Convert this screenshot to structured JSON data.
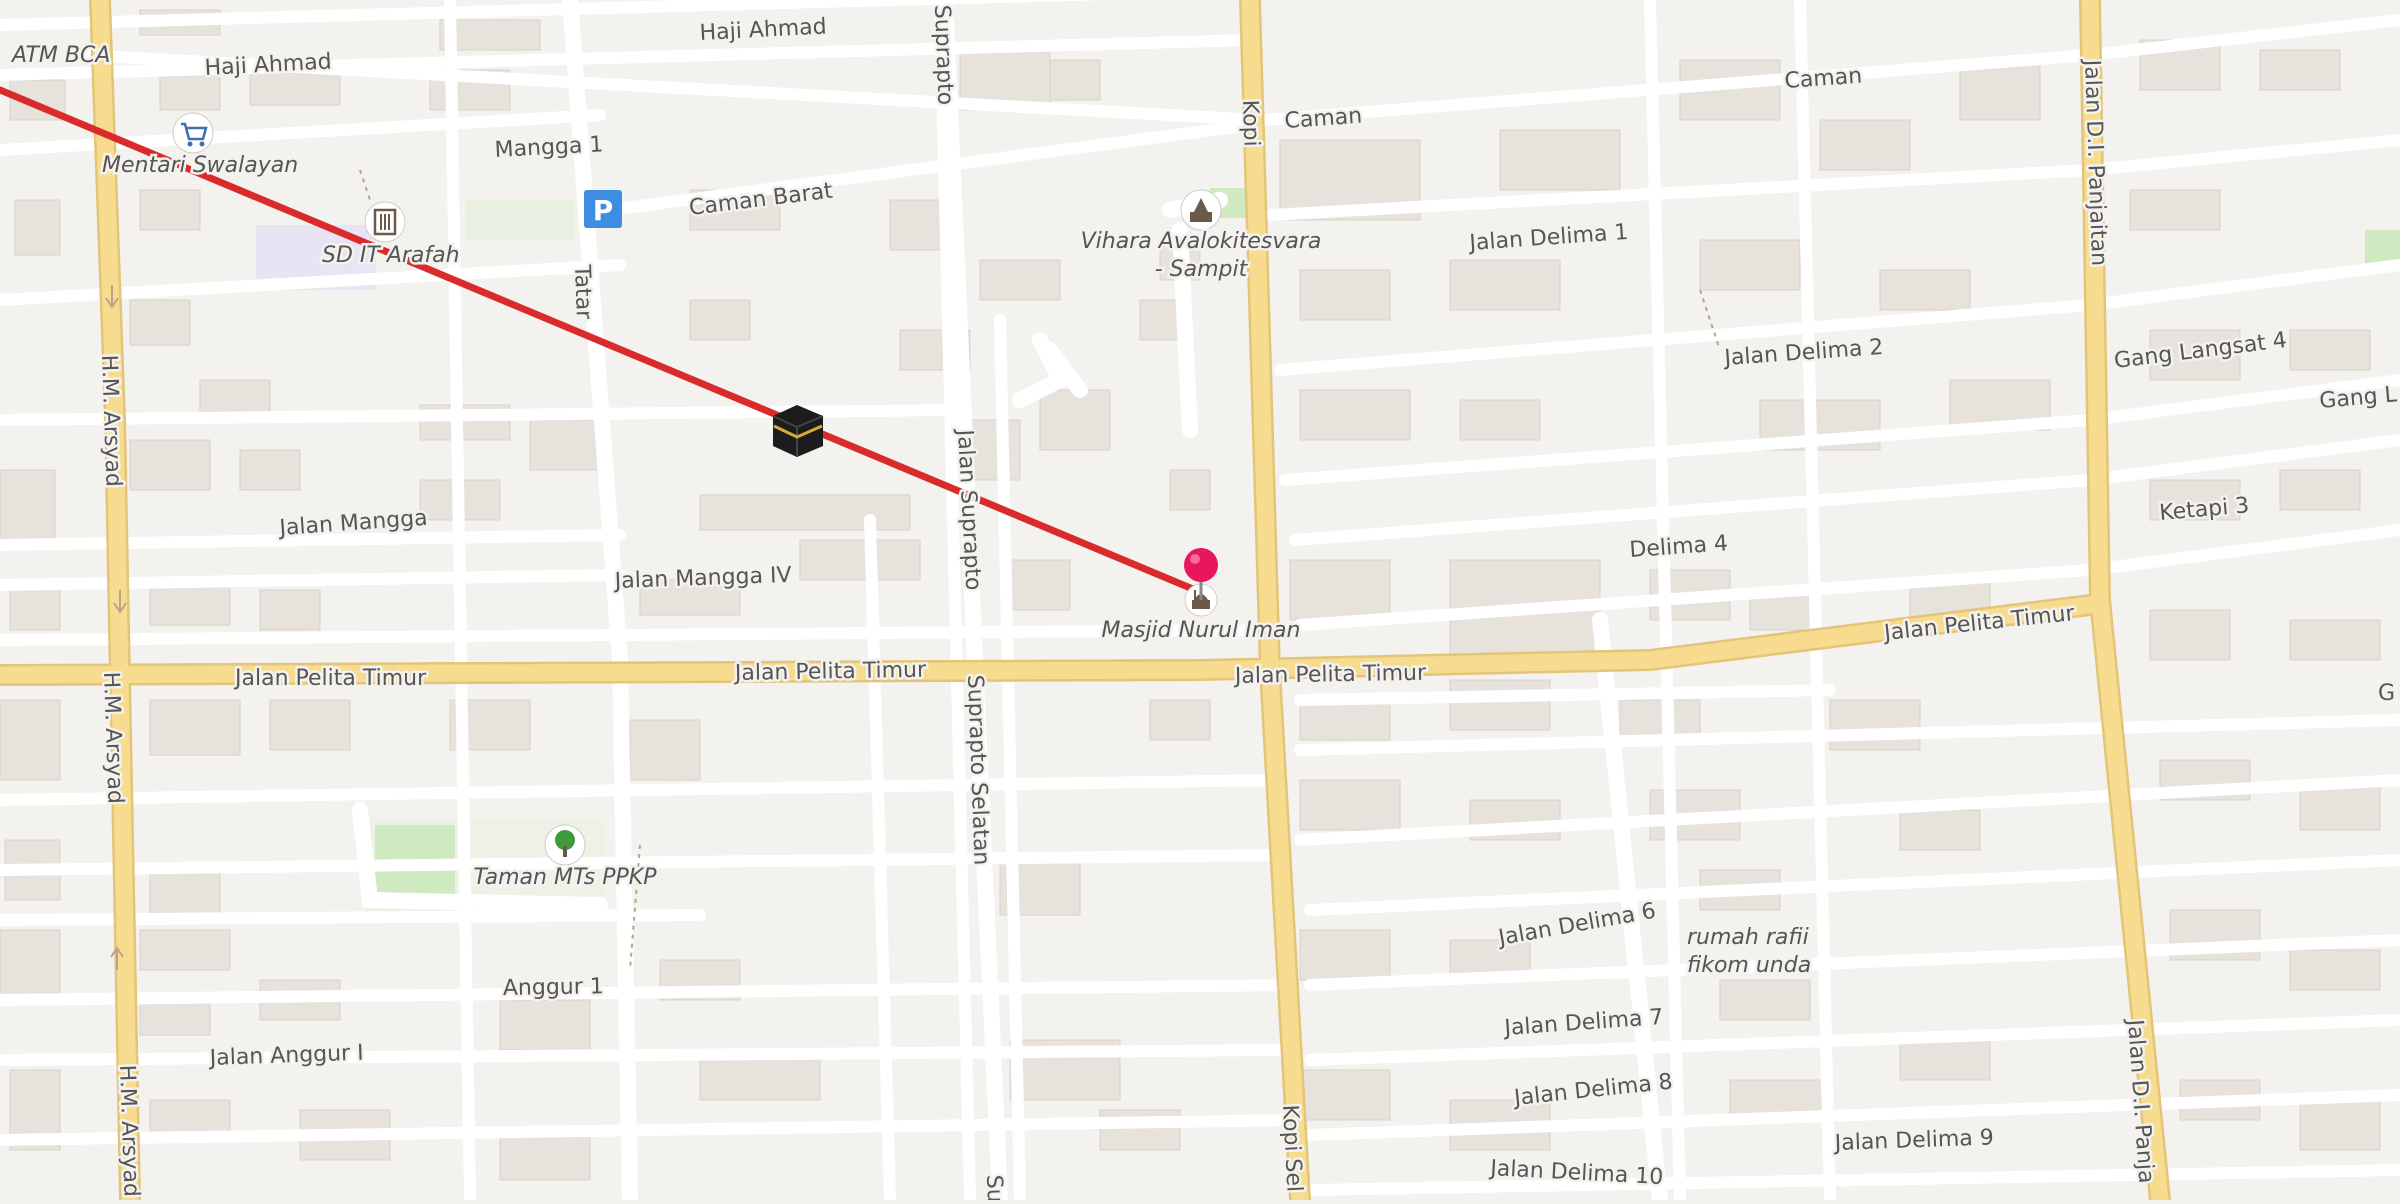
{
  "streets": {
    "haji_ahmad_1": "Haji Ahmad",
    "haji_ahmad_2": "Haji Ahmad",
    "mangga_1": "Mangga 1",
    "caman_barat": "Caman Barat",
    "caman_1": "Caman",
    "caman_2": "Caman",
    "suprapto_top": "Suprapto",
    "kopi_top": "Kopi",
    "tatar": "Tatar",
    "jalan_delima_1": "Jalan Delima 1",
    "jalan_delima_2": "Jalan Delima 2",
    "gang_langsat_4": "Gang Langsat 4",
    "gang_l": "Gang L",
    "ketapi_3": "Ketapi 3",
    "delima_4": "Delima 4",
    "jalan_mangga": "Jalan Mangga",
    "jalan_mangga_iv": "Jalan Mangga IV",
    "jalan_suprapto": "Jalan Suprapto",
    "hm_arsyad_1": "H.M. Arsyad",
    "hm_arsyad_2": "H.M. Arsyad",
    "hm_arsyad_3": "H.M. Arsyad",
    "pelita_timur_1": "Jalan Pelita Timur",
    "pelita_timur_2": "Jalan Pelita Timur",
    "pelita_timur_3": "Jalan Pelita Timur",
    "pelita_timur_4": "Jalan Pelita Timur",
    "suprapto_selatan_1": "Suprapto Selatan",
    "suprapto_selatan_2": "Su",
    "kopi_selatan": "Kopi Sel",
    "jalan_di_panjaitan_1": "Jalan D.I. Panjaitan",
    "jalan_di_panjaitan_2": "Jalan D.I. Panja",
    "jalan_delima_6": "Jalan Delima 6",
    "jalan_delima_7": "Jalan Delima 7",
    "jalan_delima_8": "Jalan Delima 8",
    "jalan_delima_9": "Jalan Delima 9",
    "jalan_delima_10": "Jalan Delima 10",
    "anggur_1": "Anggur 1",
    "jalan_anggur_i": "Jalan Anggur I",
    "g_edge": "G"
  },
  "pois": {
    "atm_bca": "ATM BCA",
    "mentari_swalayan": "Mentari Swalayan",
    "sd_it_arafah": "SD IT Arafah",
    "vihara_line1": "Vihara Avalokitesvara",
    "vihara_line2": "- Sampit",
    "masjid_nurul_iman": "Masjid Nurul Iman",
    "taman_mts_ppkp": "Taman MTs PPKP",
    "rumah_line1": "rumah rafii",
    "rumah_line2": "fikom unda",
    "parking_symbol": "P"
  },
  "icons": {
    "supermarket": "shopping-cart-icon",
    "school": "school-icon",
    "parking": "parking-icon",
    "temple": "temple-icon",
    "mosque": "mosque-icon",
    "park": "tree-icon",
    "kaaba": "kaaba-icon",
    "pin": "location-pin-icon"
  },
  "colors": {
    "background": "#f4f2ee",
    "major_road": "#f7dc8f",
    "minor_road": "#ffffff",
    "qibla_line": "#d92b2b",
    "pin": "#e8155f",
    "parking": "#3d8ee0"
  }
}
